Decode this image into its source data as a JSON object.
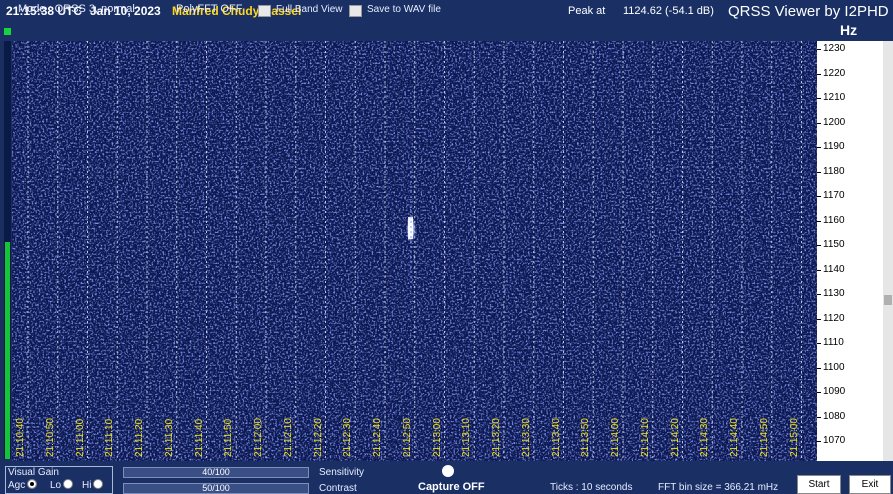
{
  "header": {
    "time": "21:15:38 UTC",
    "date": "Jan 10, 2023",
    "station": "Manfred Chudy Kassel",
    "peak_label": "Peak at",
    "peak_value": "1124.62 (-54.1 dB)",
    "app_title": "QRSS Viewer by I2PHD"
  },
  "status": {
    "mode": "Mode : QRSS 3, normal",
    "polyfft": "PolyFFT OFF",
    "full_band": "Full Band View",
    "save_wav": "Save to WAV file",
    "unit": "Hz"
  },
  "freq_axis": [
    "1230",
    "1220",
    "1210",
    "1200",
    "1190",
    "1180",
    "1170",
    "1160",
    "1150",
    "1140",
    "1130",
    "1120",
    "1110",
    "1100",
    "1090",
    "1080",
    "1070"
  ],
  "time_labels": [
    "21:10:40",
    "21:10:50",
    "21:11:00",
    "21:11:10",
    "21:11:20",
    "21:11:30",
    "21:11:40",
    "21:11:50",
    "21:12:00",
    "21:12:10",
    "21:12:20",
    "21:12:30",
    "21:12:40",
    "21:12:50",
    "21:13:00",
    "21:13:10",
    "21:13:20",
    "21:13:30",
    "21:13:40",
    "21:13:50",
    "21:14:00",
    "21:14:10",
    "21:14:20",
    "21:14:30",
    "21:14:40",
    "21:14:50",
    "21:15:00"
  ],
  "controls": {
    "visual_gain": "Visual Gain",
    "agc": "Agc",
    "lo": "Lo",
    "hi": "Hi",
    "sensitivity_value": "40/100",
    "sensitivity_label": "Sensitivity",
    "contrast_value": "50/100",
    "contrast_label": "Contrast",
    "capture": "Capture OFF",
    "ticks": "Ticks  : 10 seconds",
    "fft_bin": "FFT bin size = 366.21 mHz",
    "start": "Start",
    "exit": "Exit"
  },
  "colors": {
    "background": "#1a2f5e",
    "waterfall": "#0b1852",
    "station": "#ffd61f",
    "time_label": "#f0e020",
    "gain_bar": "#16c43a"
  }
}
